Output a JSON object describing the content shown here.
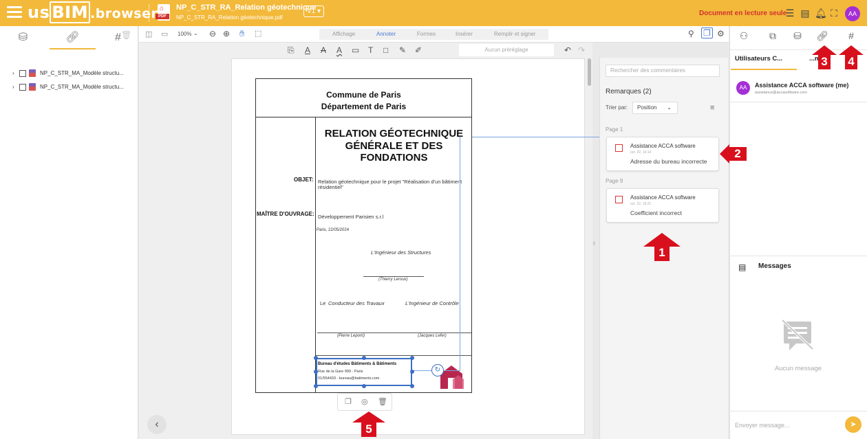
{
  "topbar": {
    "logo_us": "us",
    "logo_bim": "BIM",
    "logo_browser": ".browser",
    "doc_title": "NP_C_STR_RA_Relation géotechnique",
    "doc_subtitle": "NP_C_STR_RA_Relation géotechnique.pdf",
    "version": "V1 ▾",
    "readonly_label": "Document en lecture seule",
    "avatar_initials": "AA"
  },
  "left_panel": {
    "tabs": [
      "database-icon",
      "link-icon",
      "hash-icon"
    ],
    "tree_items": [
      {
        "label": "NP_C_STR_MA_Modèle structu..."
      },
      {
        "label": "NP_C_STR_MA_Modèle structu..."
      }
    ]
  },
  "toolbar": {
    "zoom": "100%",
    "tabs": [
      "Affichage",
      "Annoter",
      "Formes",
      "Insérer",
      "Remplir et signer"
    ],
    "active_tab": "Annoter",
    "preset_placeholder": "Aucun préréglage"
  },
  "document": {
    "header_line1": "Commune de Paris",
    "header_line2": "Département de Paris",
    "title_line1": "RELATION GÉOTECHNIQUE",
    "title_line2": "GÉNÉRALE ET DES FONDATIONS",
    "objet_label": "OBJET:",
    "objet_text_1": "Relation géotechnique pour le projet \"Réalisation d'un bâtiment",
    "objet_text_2": "résidentiel\"",
    "maitre_label": "MAÎTRE D'OUVRAGE:",
    "maitre_text": "Développement Parisien s.r.l",
    "date_text": "Paris, 22/05/2024",
    "ingenieur_structures": "L'Ingénieur des Structures",
    "thierry": "(Thierry Leroux)",
    "conducteur_prefix": "Le ",
    "conducteur": "Conducteur des Travaux",
    "ingenieur_controle": "L'Ingénieur de Contrôle",
    "pierre": "(Pierre Lepont)",
    "jacques": "(Jacques Lefer)",
    "bureau_name": "Bureau d'études Bâtiments & Bâtiments",
    "bureau_addr": "Rue de la Gare 999 - Paris",
    "bureau_contact": "01/554433 - bureau@batiments.com"
  },
  "comments": {
    "search_placeholder": "Rechercher des commentaires",
    "title": "Remarques (2)",
    "sort_label": "Trier par:",
    "sort_value": "Position",
    "groups": [
      {
        "page": "Page 1",
        "author": "Assistance ACCA software",
        "date": "oct. 22, 16:14",
        "message": "Adresse du bureau incorrecte"
      },
      {
        "page": "Page 9",
        "author": "Assistance ACCA software",
        "date": "oct. 22, 16:21",
        "message": "Coefficient incorrect"
      }
    ]
  },
  "right_panel": {
    "users_tab": "Utilisateurs C...",
    "groups_tab": "...me",
    "user_initials": "AA",
    "user_name": "Assistance ACCA software (me)",
    "user_email": "assistance@accasoftware.com",
    "messages_title": "Messages",
    "empty_text": "Aucun message",
    "input_placeholder": "Envoyer message..."
  },
  "callouts": {
    "c1": "1",
    "c2": "2",
    "c3": "3",
    "c4": "4",
    "c5": "5"
  },
  "colors": {
    "brand": "#f3b93a",
    "accent_blue": "#4a7bd0",
    "callout_red": "#d8101d",
    "avatar": "#a52fd6",
    "readonly_red": "#d2322d"
  }
}
